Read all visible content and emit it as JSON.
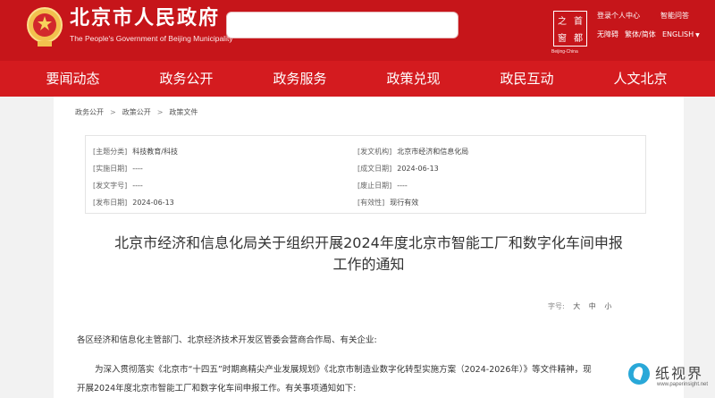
{
  "header": {
    "site_title": "北京市人民政府",
    "site_subtitle": "The People's Government of Beijing Municipality",
    "search_placeholder": "",
    "capital_logo_chars": [
      "首",
      "都",
      "之",
      "窗"
    ],
    "capital_logo_caption": "Beijing-China",
    "links": {
      "login": "登录个人中心",
      "assistant": "智能问答",
      "accessibility": "无障碍",
      "language_switch": "繁体/简体",
      "english": "ENGLISH"
    },
    "colors": {
      "header_bg": "#c6151a",
      "nav_bg": "#d41b1f"
    }
  },
  "nav": {
    "items": [
      "要闻动态",
      "政务公开",
      "政务服务",
      "政策兑现",
      "政民互动",
      "人文北京"
    ]
  },
  "breadcrumb": [
    "政务公开",
    "政策公开",
    "政策文件"
  ],
  "meta": {
    "topic_key": "[主题分类]",
    "topic_val": "科技教育/科技",
    "issuer_key": "[发文机构]",
    "issuer_val": "北京市经济和信息化局",
    "effective_key": "[实施日期]",
    "effective_val": "----",
    "created_key": "[成文日期]",
    "created_val": "2024-06-13",
    "docno_key": "[发文字号]",
    "docno_val": "----",
    "repeal_key": "[废止日期]",
    "repeal_val": "----",
    "published_key": "[发布日期]",
    "published_val": "2024-06-13",
    "validity_key": "[有效性]",
    "validity_val": "现行有效"
  },
  "document": {
    "title_line1": "北京市经济和信息化局关于组织开展2024年度北京市智能工厂和数字化车间申报",
    "title_line2": "工作的通知",
    "fontsize_label": "字号:",
    "fontsize_options": [
      "大",
      "中",
      "小"
    ],
    "para1": "各区经济和信息化主管部门、北京经济技术开发区管委会营商合作局、有关企业:",
    "para2": "为深入贯彻落实《北京市“十四五”时期高精尖产业发展规划》《北京市制造业数字化转型实施方案（2024-2026年）》等文件精神，现",
    "para3": "开展2024年度北京市智能工厂和数字化车间申报工作。有关事项通知如下:"
  },
  "watermark": {
    "brand": "纸视界",
    "url": "www.paperinsight.net"
  }
}
